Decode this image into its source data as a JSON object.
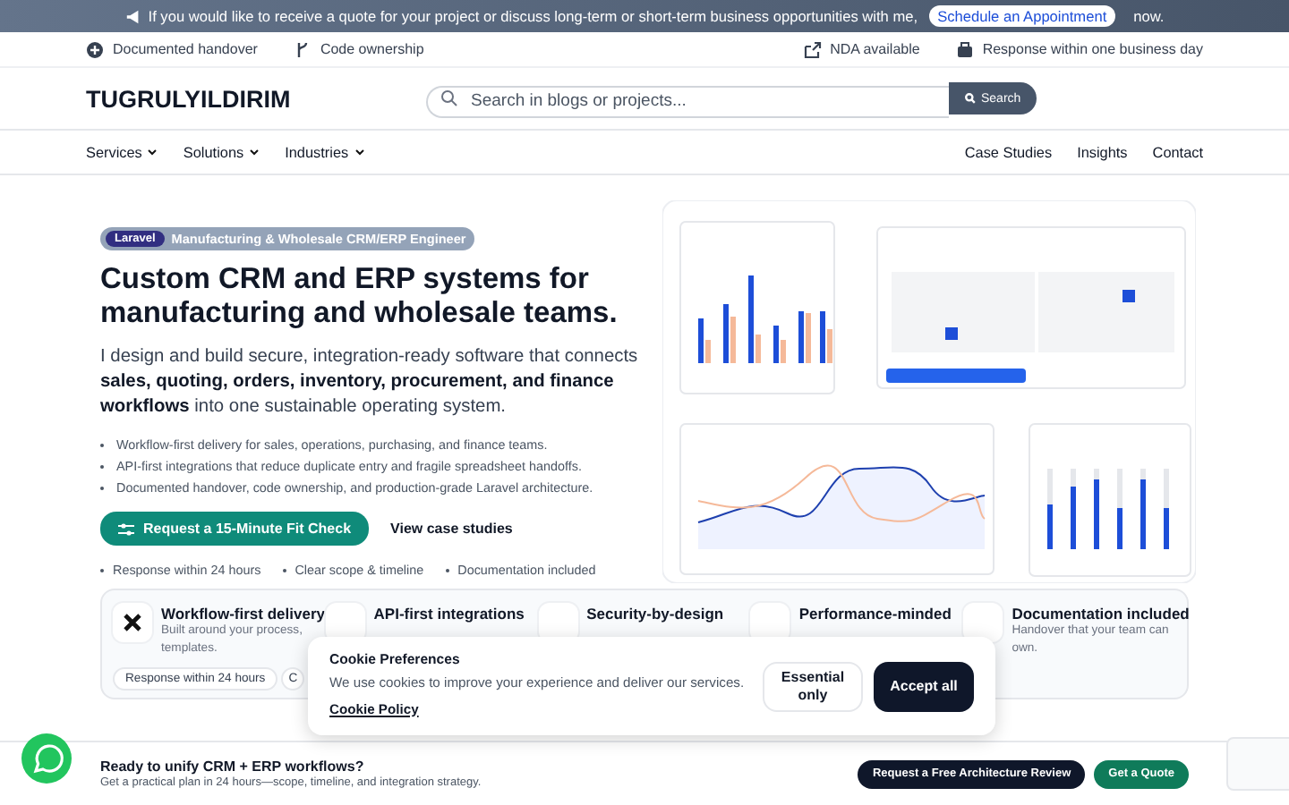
{
  "announcement": {
    "text": "If you would like to receive a quote for your project or discuss long-term or short-term business opportunities with me,",
    "link": "Schedule an Appointment",
    "suffix": "now."
  },
  "trust_bar": {
    "left": [
      "Documented handover",
      "Code ownership"
    ],
    "right": [
      "NDA available",
      "Response within one business day"
    ]
  },
  "header": {
    "logo": "TUGRULYILDIRIM",
    "search": {
      "placeholder": "Search in blogs or projects...",
      "button": "Search"
    }
  },
  "nav": {
    "menus": [
      "Services",
      "Solutions",
      "Industries"
    ],
    "links": [
      "Case Studies",
      "Insights",
      "Contact"
    ]
  },
  "hero": {
    "badge": {
      "tag": "Laravel",
      "text": "Manufacturing & Wholesale CRM/ERP Engineer"
    },
    "title": "Custom CRM and ERP systems for manufacturing and wholesale teams.",
    "intro": "I design and build secure, integration-ready software that connects **sales, quoting, orders, inventory, procurement, and finance workflows** into one sustainable operating system.",
    "bullets": [
      "Workflow-first delivery for sales, operations, purchasing, and finance teams.",
      "API-first integrations that reduce duplicate entry and fragile spreadsheet handoffs.",
      "Documented handover, code ownership, and production-grade Laravel architecture."
    ],
    "primary_button": "Request a 15-Minute Fit Check",
    "secondary_link": "View case studies",
    "assurances": [
      "Response within 24 hours",
      "Clear scope & timeline",
      "Documentation included"
    ]
  },
  "features": [
    {
      "title": "Workflow-first delivery",
      "description": [
        "Built around your process,",
        "templates."
      ],
      "chips": [
        "Response within 24 hours",
        "C"
      ]
    },
    {
      "title": "API-first integrations"
    },
    {
      "title": "Security-by-design"
    },
    {
      "title": "Performance-minded"
    },
    {
      "title": "Documentation included",
      "description": [
        "Handover that your team can",
        "own."
      ]
    }
  ],
  "cookie_banner": {
    "title": "Cookie Preferences",
    "text": "We use cookies to improve your experience and deliver our services.",
    "link": "Cookie Policy",
    "buttons": [
      {
        "label": "Essential only",
        "kind": "secondary"
      },
      {
        "label": "Accept all",
        "kind": "primary"
      }
    ]
  },
  "cta_bar": {
    "title": "Ready to unify CRM + ERP workflows?",
    "subtitle": "Get a practical plan in 24 hours—scope, timeline, and integration strategy.",
    "buttons": [
      {
        "label": "Request a Free Architecture Review",
        "kind": "dark"
      },
      {
        "label": "Get a Quote",
        "kind": "green"
      }
    ]
  }
}
